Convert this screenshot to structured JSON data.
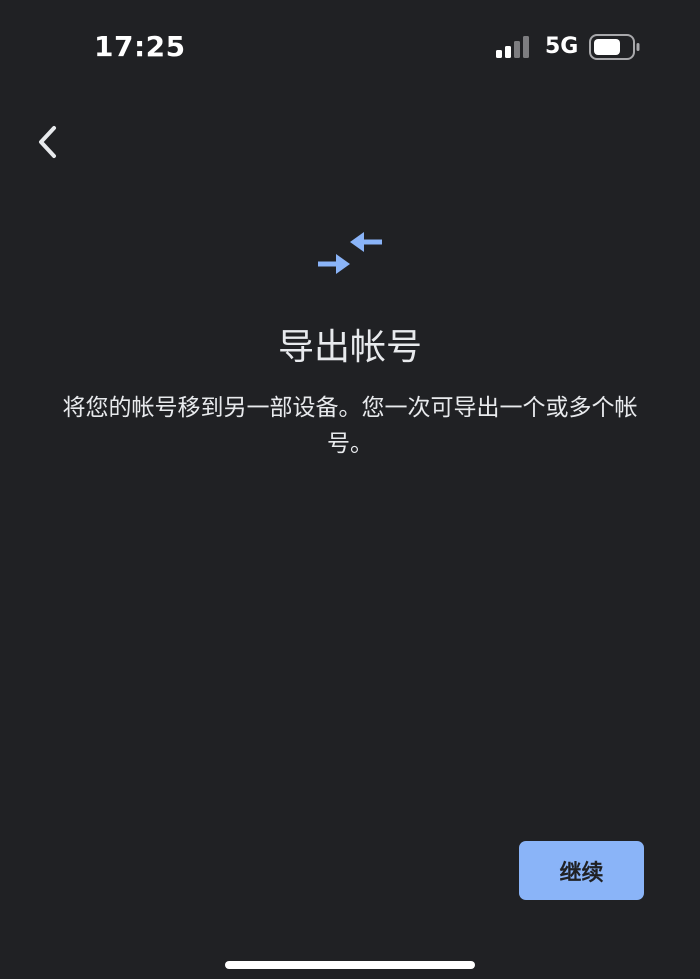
{
  "status_bar": {
    "time": "17:25",
    "network": "5G",
    "signal_icon": "signal-bars-icon",
    "battery_icon": "battery-icon"
  },
  "nav": {
    "back_icon": "chevron-left-icon"
  },
  "hero": {
    "icon": "transfer-arrows-icon",
    "icon_color": "#8ab4f8",
    "title": "导出帐号",
    "description": "将您的帐号移到另一部设备。您一次可导出一个或多个帐号。"
  },
  "actions": {
    "continue_label": "继续",
    "continue_color": "#8ab4f8"
  },
  "colors": {
    "background": "#202124",
    "text": "#e8eaed"
  }
}
